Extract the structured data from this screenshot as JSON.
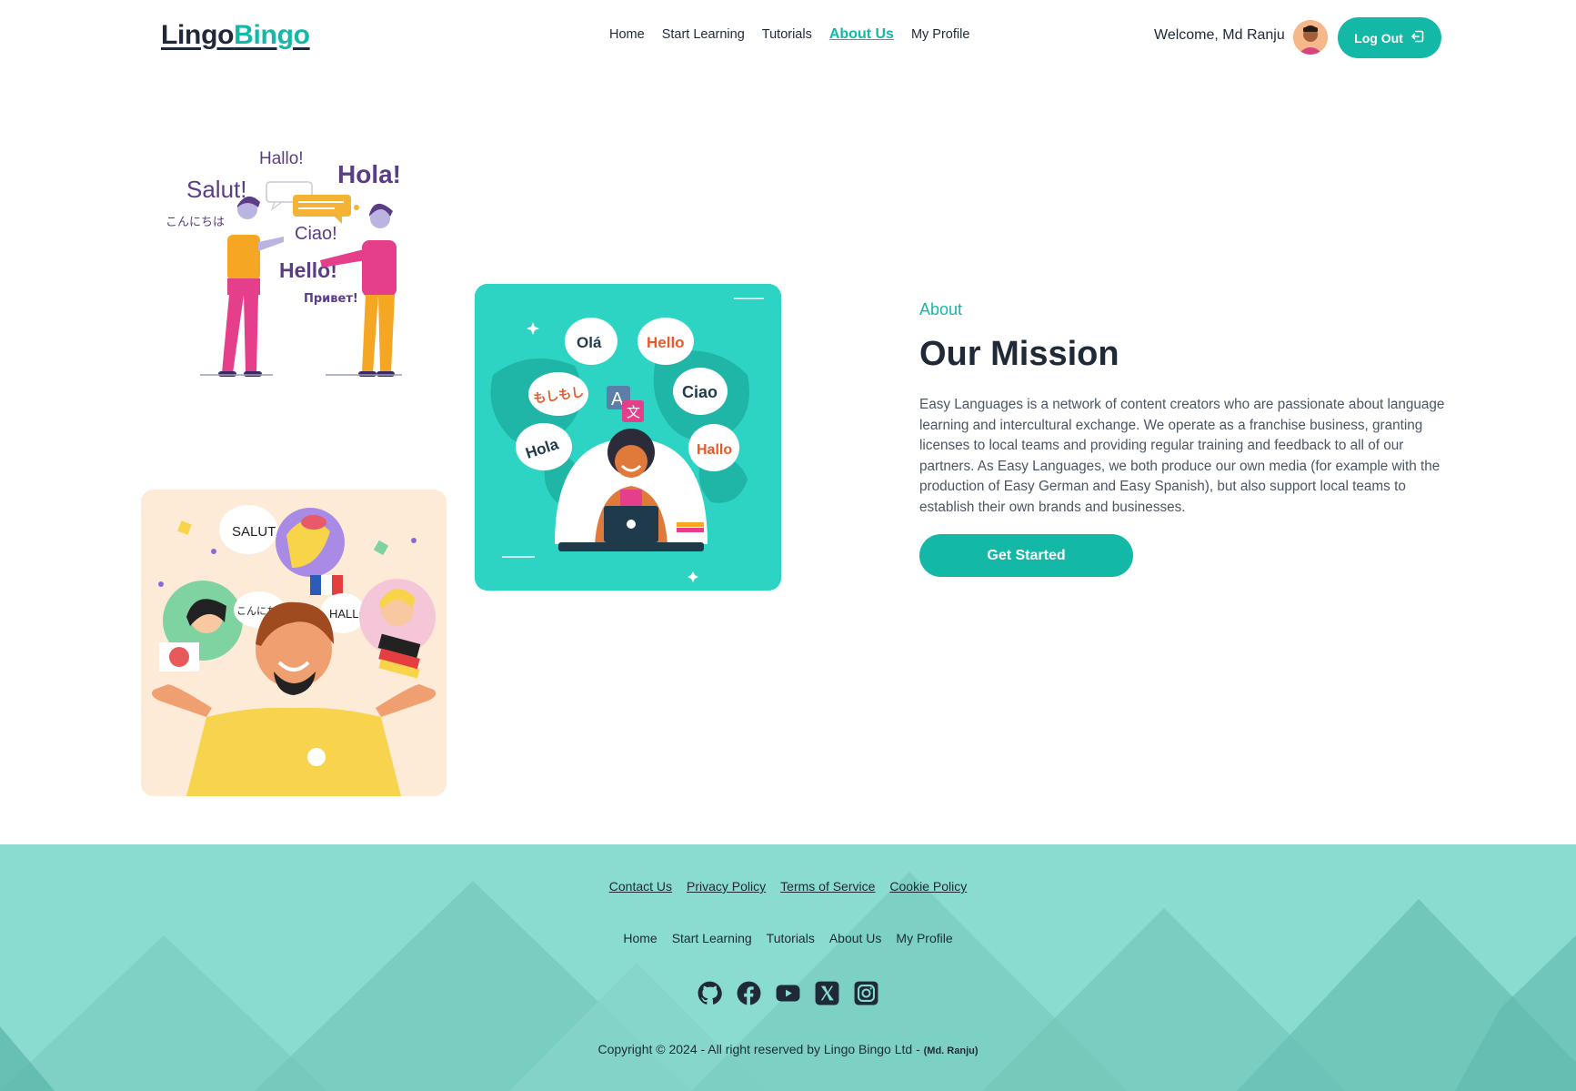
{
  "brand": {
    "part1": "Lingo",
    "part2": "Bingo"
  },
  "nav": {
    "links": [
      "Home",
      "Start Learning",
      "Tutorials",
      "About Us",
      "My Profile"
    ],
    "active": "About Us"
  },
  "user": {
    "welcome": "Welcome, Md Ranju",
    "logout_label": "Log Out"
  },
  "illustrations": {
    "greetings_1": [
      "Hallo!",
      "Salut!",
      "Hola!",
      "こんにちは",
      "Ciao!",
      "Hello!",
      "Привет!"
    ],
    "greetings_2": [
      "Olá",
      "Hello",
      "もしもし",
      "Ciao",
      "Hola",
      "Hallo"
    ],
    "greetings_3": [
      "SALUT",
      "こんにちは",
      "HALLO"
    ]
  },
  "about": {
    "label": "About",
    "title": "Our Mission",
    "text": "Easy Languages is a network of content creators who are passionate about language learning and intercultural exchange. We operate as a franchise business, granting licenses to local teams and providing regular training and feedback to all of our partners. As Easy Languages, we both produce our own media (for example with the production of Easy German and Easy Spanish), but also support local teams to establish their own brands and businesses.",
    "cta": "Get Started"
  },
  "footer": {
    "legal_links": [
      "Contact Us",
      "Privacy Policy",
      "Terms of Service",
      "Cookie Policy"
    ],
    "nav_links": [
      "Home",
      "Start Learning",
      "Tutorials",
      "About Us",
      "My Profile"
    ],
    "socials": [
      "github-icon",
      "facebook-icon",
      "youtube-icon",
      "x-icon",
      "instagram-icon"
    ],
    "copyright": "Copyright © 2024 - All right reserved by Lingo Bingo Ltd - ",
    "copyright_author": "(Md. Ranju)"
  },
  "colors": {
    "accent": "#14b8a6",
    "footer_bg": "#8adbd0",
    "text": "#1f2937"
  }
}
